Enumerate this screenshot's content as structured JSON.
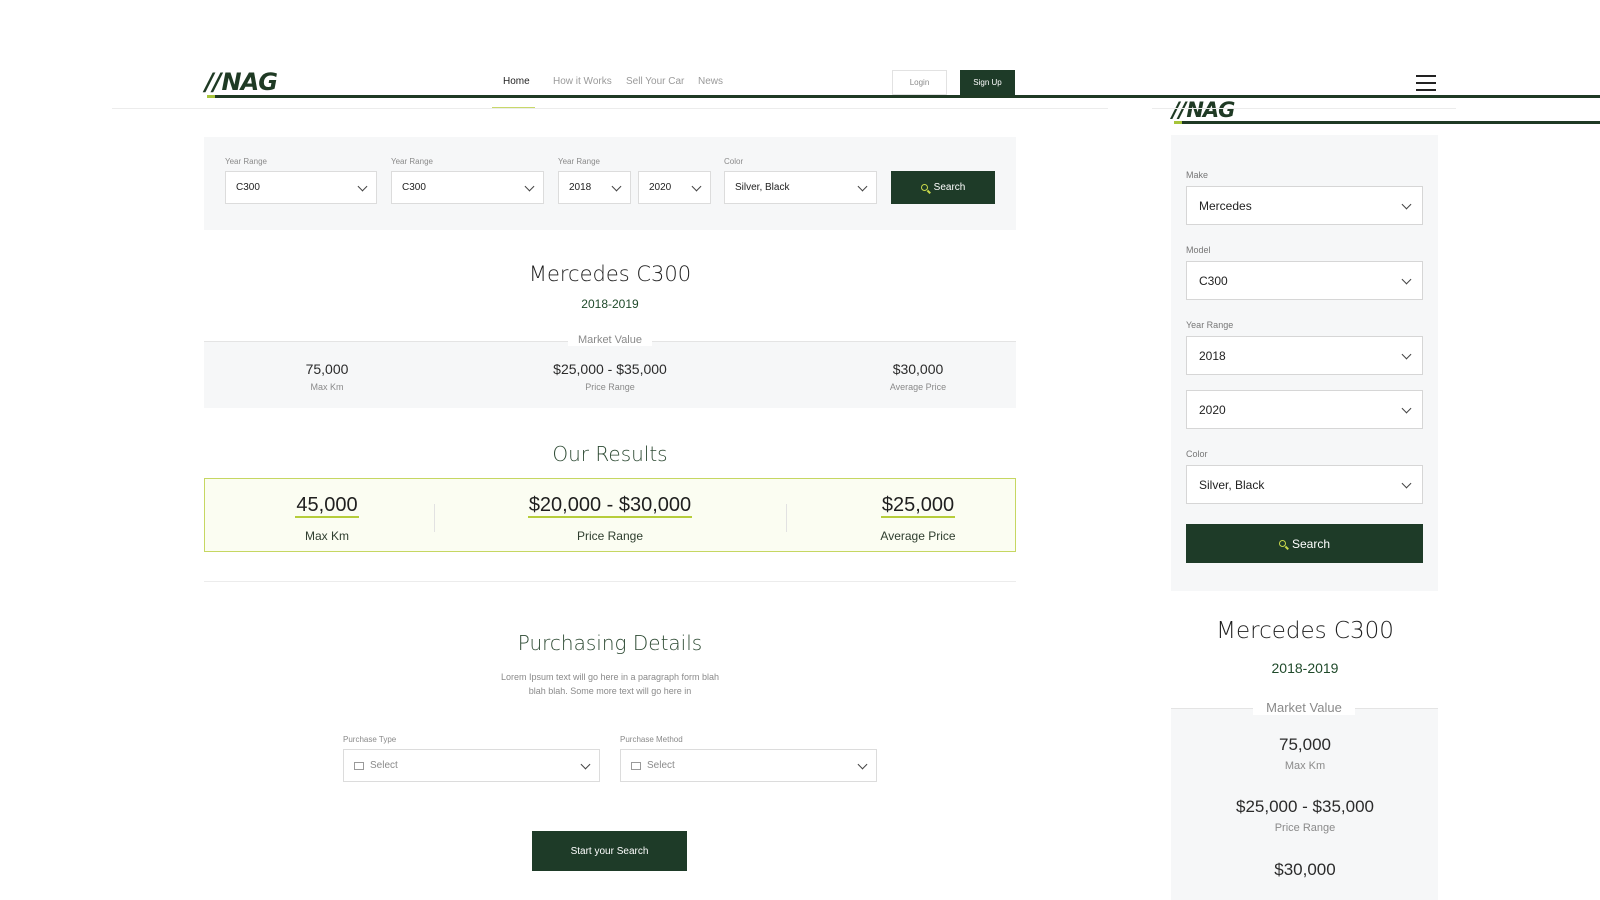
{
  "brand": {
    "logo_text": "NAG"
  },
  "nav": {
    "home": "Home",
    "how_it_works": "How it Works",
    "sell_your_car": "Sell Your Car",
    "news": "News",
    "login": "Login",
    "signup": "Sign Up"
  },
  "filters": {
    "f1_label": "Year Range",
    "f1_value": "C300",
    "f2_label": "Year Range",
    "f2_value": "C300",
    "f3_label": "Year Range",
    "f3_from": "2018",
    "f3_to": "2020",
    "f4_label": "Color",
    "f4_value": "Silver, Black",
    "search": "Search"
  },
  "car": {
    "title": "Mercedes C300",
    "years": "2018-2019"
  },
  "market": {
    "label": "Market Value",
    "max_km": "75,000",
    "max_km_label": "Max Km",
    "price_range": "$25,000 - $35,000",
    "price_range_label": "Price Range",
    "avg_price": "$30,000",
    "avg_price_label": "Average Price"
  },
  "results": {
    "title": "Our Results",
    "max_km": "45,000",
    "max_km_label": "Max Km",
    "price_range": "$20,000 - $30,000",
    "price_range_label": "Price Range",
    "avg_price": "$25,000",
    "avg_price_label": "Average Price"
  },
  "purchasing": {
    "title": "Purchasing Details",
    "para_line1": "Lorem Ipsum text will go here in a paragraph form blah",
    "para_line2": "blah blah. Some more text will go here in",
    "type_label": "Purchase Type",
    "type_value": "Select",
    "method_label": "Purchase Method",
    "method_value": "Select",
    "start": "Start your Search"
  },
  "mobile": {
    "make_label": "Make",
    "make_value": "Mercedes",
    "model_label": "Model",
    "model_value": "C300",
    "year_label": "Year Range",
    "year_from": "2018",
    "year_to": "2020",
    "color_label": "Color",
    "color_value": "Silver, Black",
    "search": "Search",
    "title": "Mercedes C300",
    "years": "2018-2019",
    "mv_label": "Market Value",
    "max_km": "75,000",
    "max_km_label": "Max Km",
    "price_range": "$25,000 - $35,000",
    "price_range_label": "Price Range",
    "avg_price": "$30,000"
  },
  "colors": {
    "primary": "#1e3b28",
    "accent": "#b6cd3a",
    "panel": "#f6f7f8"
  },
  "icons": [
    "chevron-down-icon",
    "search-icon",
    "menu-icon",
    "calendar-icon",
    "card-icon"
  ]
}
